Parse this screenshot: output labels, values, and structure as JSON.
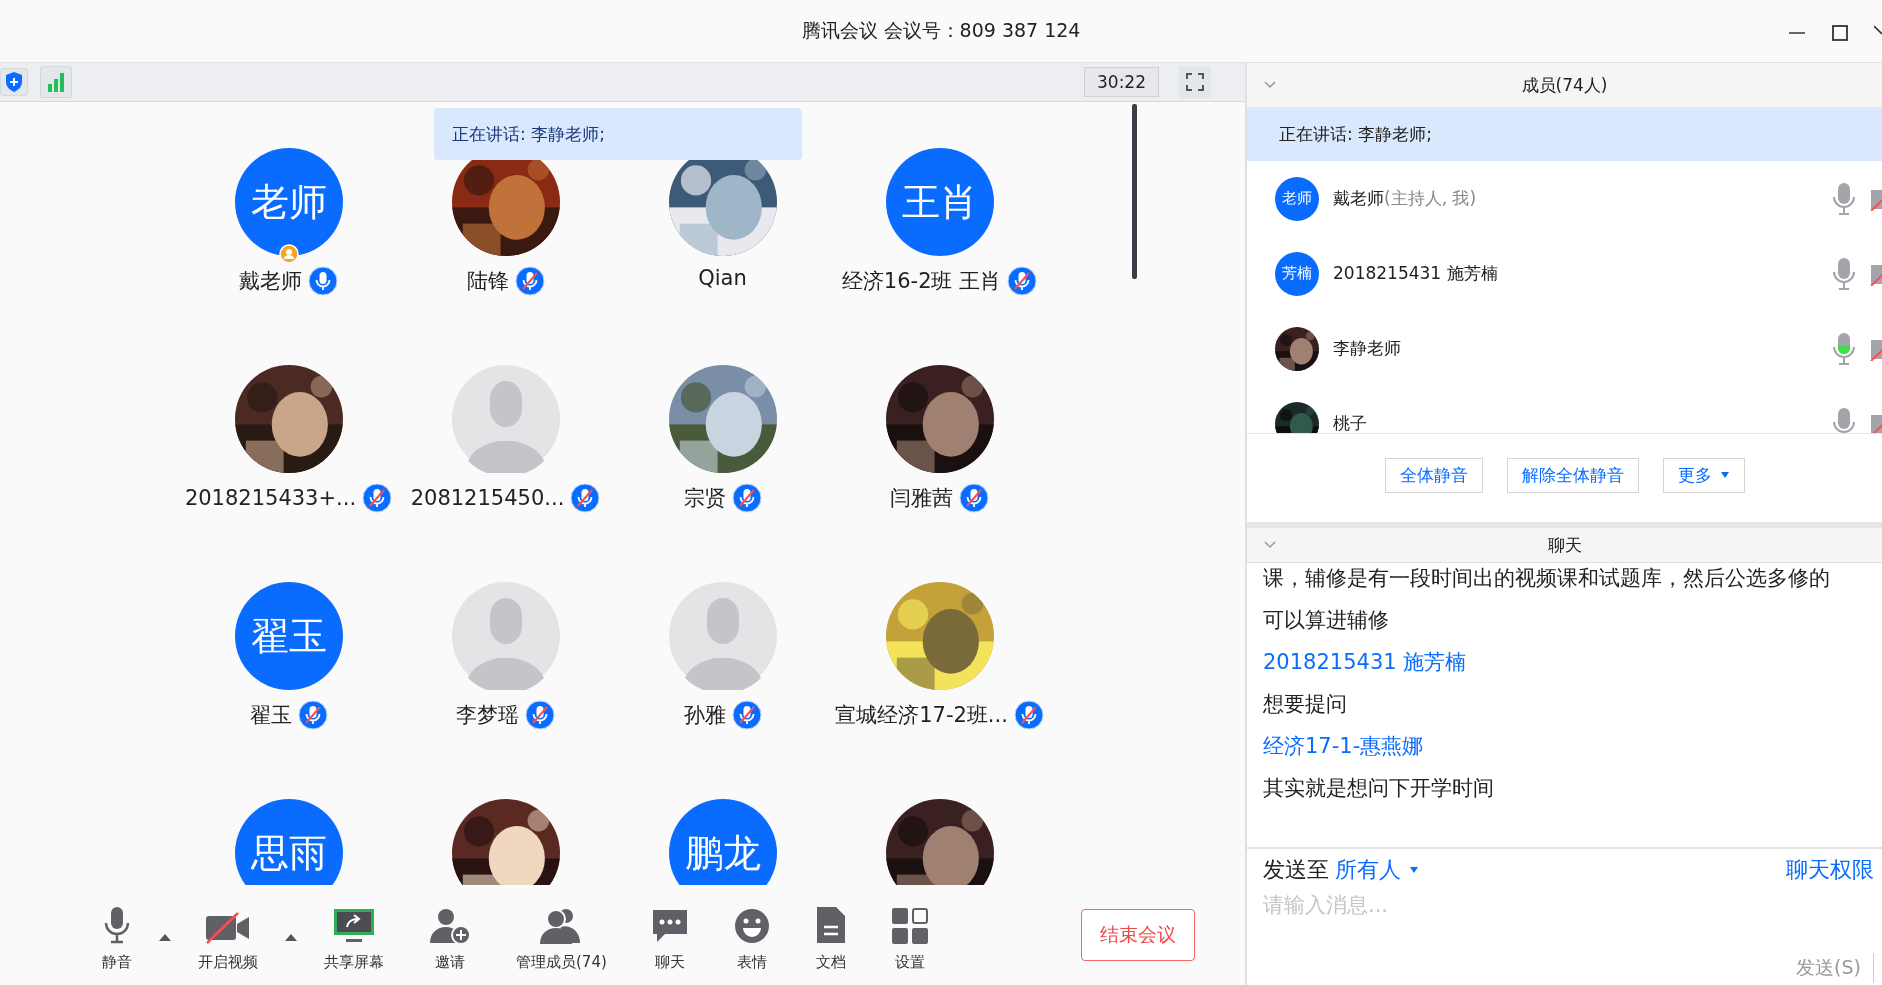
{
  "window": {
    "title": "腾讯会议 会议号：809 387 124"
  },
  "meeting_bar": {
    "timer": "30:22"
  },
  "speaking_banner": "正在讲话: 李静老师;",
  "participants": [
    {
      "kind": "initials",
      "initials": "老师",
      "name": "戴老师",
      "mic": true,
      "muted": false,
      "host": true
    },
    {
      "kind": "picture",
      "name": "陆锋",
      "mic": true,
      "muted": true,
      "host": false
    },
    {
      "kind": "picture",
      "name": "Qian",
      "mic": false,
      "host": false
    },
    {
      "kind": "initials",
      "initials": "王肖",
      "name": "经济16-2班 王肖",
      "mic": true,
      "muted": true,
      "host": false
    },
    {
      "kind": "picture",
      "name": "2018215433+...",
      "mic": true,
      "muted": true,
      "host": false
    },
    {
      "kind": "placeholder",
      "name": "2081215450...",
      "mic": true,
      "muted": true,
      "host": false
    },
    {
      "kind": "picture",
      "name": "宗贤",
      "mic": true,
      "muted": true,
      "host": false
    },
    {
      "kind": "picture",
      "name": "闫雅茜",
      "mic": true,
      "muted": true,
      "host": false
    },
    {
      "kind": "initials",
      "initials": "翟玉",
      "name": "翟玉",
      "mic": true,
      "muted": true,
      "host": false
    },
    {
      "kind": "placeholder",
      "name": "李梦瑶",
      "mic": true,
      "muted": true,
      "host": false
    },
    {
      "kind": "placeholder",
      "name": "孙雅",
      "mic": true,
      "muted": true,
      "host": false
    },
    {
      "kind": "picture",
      "name": "宣城经济17-2班...",
      "mic": true,
      "muted": true,
      "host": false
    },
    {
      "kind": "initials",
      "initials": "思雨"
    },
    {
      "kind": "picture"
    },
    {
      "kind": "initials",
      "initials": "鹏龙"
    },
    {
      "kind": "picture"
    }
  ],
  "toolbar": [
    {
      "kind": "mic",
      "label": "静音",
      "caret": true
    },
    {
      "kind": "video",
      "label": "开启视频",
      "caret": true
    },
    {
      "kind": "share",
      "label": "共享屏幕",
      "caret": false
    },
    {
      "kind": "invite",
      "label": "邀请",
      "caret": false
    },
    {
      "kind": "members",
      "label": "管理成员(74)",
      "caret": false
    },
    {
      "kind": "chat",
      "label": "聊天",
      "caret": false
    },
    {
      "kind": "emoji",
      "label": "表情",
      "caret": false
    },
    {
      "kind": "docs",
      "label": "文档",
      "caret": false
    },
    {
      "kind": "settings",
      "label": "设置",
      "caret": false
    }
  ],
  "end_button": "结束会议",
  "members_panel": {
    "title": "成员(74人)",
    "speaking": "正在讲话: 李静老师;",
    "members": [
      {
        "kind": "initials",
        "initials": "老师",
        "name": "戴老师",
        "note": "(主持人, 我)",
        "speaking": false
      },
      {
        "kind": "initials",
        "initials": "芳楠",
        "name": "2018215431 施芳楠",
        "speaking": false
      },
      {
        "kind": "picture",
        "name": "李静老师",
        "speaking": true
      },
      {
        "kind": "picture",
        "name": "桃子",
        "speaking": false
      }
    ],
    "buttons": [
      {
        "label": "全体静音",
        "caret": false
      },
      {
        "label": "解除全体静音",
        "caret": false
      },
      {
        "label": "更多",
        "caret": true
      }
    ]
  },
  "chat_panel": {
    "title": "聊天",
    "messages": [
      {
        "kind": "text",
        "text": "课，辅修是有一段时间出的视频课和试题库，然后公选多修的"
      },
      {
        "kind": "text",
        "text": "可以算进辅修"
      },
      {
        "kind": "sender",
        "text": "2018215431 施芳楠"
      },
      {
        "kind": "text",
        "text": "想要提问"
      },
      {
        "kind": "sender",
        "text": "经济17-1-惠燕娜"
      },
      {
        "kind": "text",
        "text": "其实就是想问下开学时间"
      }
    ],
    "send_to_label": "发送至",
    "send_to": "所有人",
    "permissions": "聊天权限",
    "placeholder": "请输入消息...",
    "send_button": "发送(S)"
  }
}
